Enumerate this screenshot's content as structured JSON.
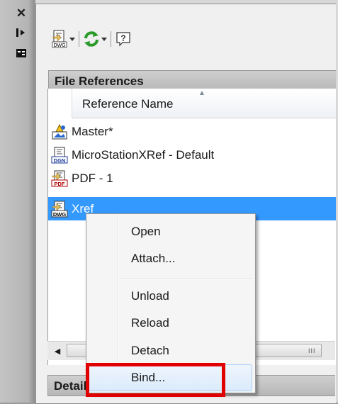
{
  "palette": {
    "close_glyph": "✕"
  },
  "toolbar": {
    "attach_icon_caption": "DWG"
  },
  "file_references": {
    "title": "File References",
    "column_header": "Reference Name",
    "rows": [
      {
        "label": "Master*",
        "icon": "master-drawing-icon"
      },
      {
        "label": "MicroStationXRef - Default",
        "icon": "dgn-file-icon",
        "icon_caption": "DGN"
      },
      {
        "label": "PDF - 1",
        "icon": "pdf-file-icon",
        "icon_caption": "PDF"
      },
      {
        "label": "Xref",
        "icon": "dwg-file-icon",
        "icon_caption": "DWG",
        "selected": true
      }
    ]
  },
  "details": {
    "title": "Details"
  },
  "scrollbar": {
    "grip": "III"
  },
  "context_menu": {
    "items": [
      {
        "label": "Open"
      },
      {
        "label": "Attach..."
      },
      {
        "label": "Unload"
      },
      {
        "label": "Reload"
      },
      {
        "label": "Detach"
      },
      {
        "label": "Bind...",
        "highlighted": true
      }
    ]
  },
  "colors": {
    "selection": "#3399ff",
    "highlight_box": "#e00000"
  }
}
